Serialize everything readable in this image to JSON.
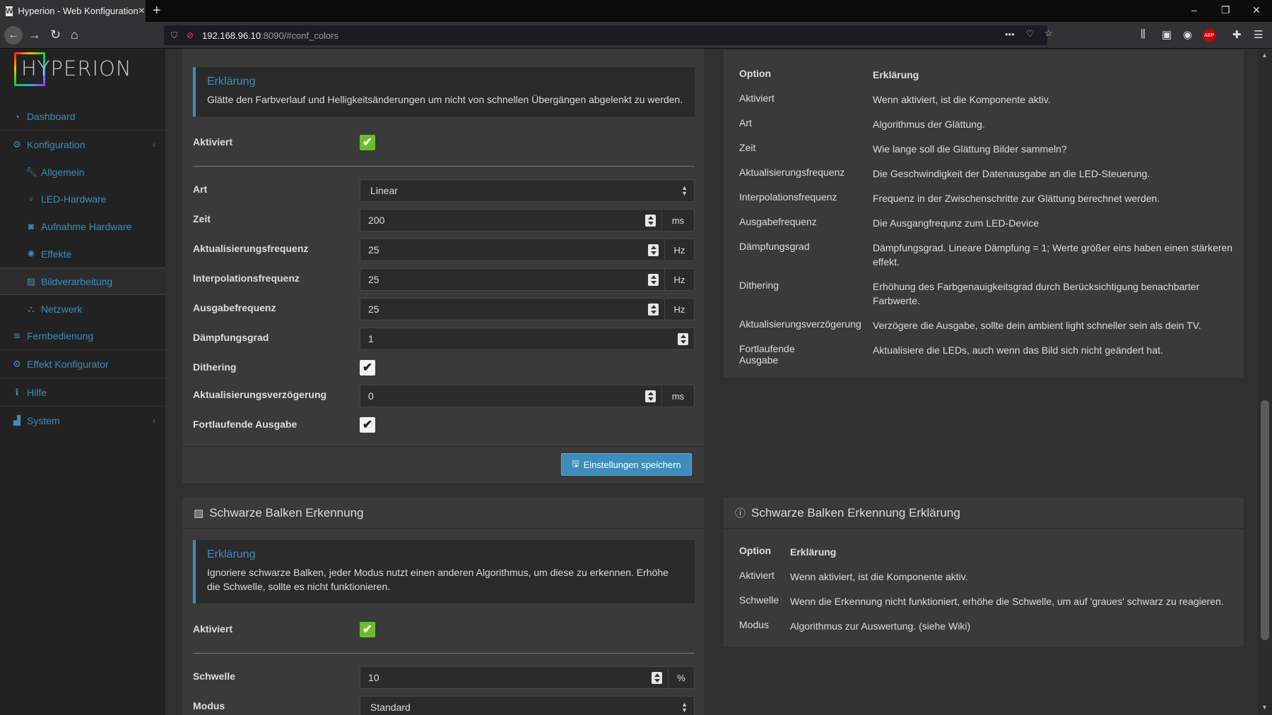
{
  "browser": {
    "tab_title": "Hyperion - Web Konfiguration",
    "favicon": "W",
    "url_host": "192.168.96.10",
    "url_rest": ":8090/#conf_colors"
  },
  "sidebar": {
    "logo_text": "HYPERION",
    "items": [
      {
        "label": "Dashboard",
        "icon": "dashboard-icon"
      },
      {
        "label": "Konfiguration",
        "icon": "gear-icon"
      },
      {
        "label": "Allgemein",
        "icon": "wrench-icon"
      },
      {
        "label": "LED-Hardware",
        "icon": "lightbulb-icon"
      },
      {
        "label": "Aufnahme Hardware",
        "icon": "camera-icon"
      },
      {
        "label": "Effekte",
        "icon": "spinner-icon"
      },
      {
        "label": "Bildverarbeitung",
        "icon": "picture-icon"
      },
      {
        "label": "Netzwerk",
        "icon": "network-icon"
      },
      {
        "label": "Fernbedienung",
        "icon": "wifi-icon"
      },
      {
        "label": "Effekt Konfigurator",
        "icon": "cogs-icon"
      },
      {
        "label": "Hilfe",
        "icon": "info-icon"
      },
      {
        "label": "System",
        "icon": "chart-icon"
      }
    ]
  },
  "smoothing": {
    "callout_title": "Erklärung",
    "callout_text": "Glätte den Farbverlauf und Helligkeitsänderungen um nicht von schnellen Übergängen abgelenkt zu werden.",
    "enabled_label": "Aktiviert",
    "art_label": "Art",
    "art_value": "Linear",
    "zeit_label": "Zeit",
    "zeit_value": "200",
    "zeit_unit": "ms",
    "update_freq_label": "Aktualisierungsfrequenz",
    "update_freq_value": "25",
    "update_freq_unit": "Hz",
    "interp_label": "Interpolationsfrequenz",
    "interp_value": "25",
    "interp_unit": "Hz",
    "output_label": "Ausgabefrequenz",
    "output_value": "25",
    "output_unit": "Hz",
    "damping_label": "Dämpfungsgrad",
    "damping_value": "1",
    "dithering_label": "Dithering",
    "delay_label": "Aktualisierungsverzögerung",
    "delay_value": "0",
    "delay_unit": "ms",
    "continuous_label": "Fortlaufende Ausgabe",
    "save_label": "Einstellungen speichern"
  },
  "smoothing_help": {
    "head_option": "Option",
    "head_explain": "Erklärung",
    "rows": [
      {
        "option": "Aktiviert",
        "text": "Wenn aktiviert, ist die Komponente aktiv."
      },
      {
        "option": "Art",
        "text": "Algorithmus der Glättung."
      },
      {
        "option": "Zeit",
        "text": "Wie lange soll die Glättung Bilder sammeln?"
      },
      {
        "option": "Aktualisierungsfrequenz",
        "text": "Die Geschwindigkeit der Datenausgabe an die LED-Steuerung."
      },
      {
        "option": "Interpolationsfrequenz",
        "text": "Frequenz in der Zwischenschritte zur Glättung berechnet werden."
      },
      {
        "option": "Ausgabefrequenz",
        "text": "Die Ausgangfrequnz zum LED-Device"
      },
      {
        "option": "Dämpfungsgrad",
        "text": "Dämpfungsgrad. Lineare Dämpfung = 1; Werte größer eins haben einen stärkeren effekt."
      },
      {
        "option": "Dithering",
        "text": "Erhöhung des Farbgenauigkeitsgrad durch Berücksichtigung benachbarter Farbwerte."
      },
      {
        "option": "Aktualisierungsverzögerung",
        "text": "Verzögere die Ausgabe, sollte dein ambient light schneller sein als dein TV."
      },
      {
        "option": "Fortlaufende Ausgabe",
        "text": "Aktualisiere die LEDs, auch wenn das Bild sich nicht geändert hat."
      }
    ]
  },
  "blackbar": {
    "title": "Schwarze Balken Erkennung",
    "callout_title": "Erklärung",
    "callout_text": "Ignoriere schwarze Balken, jeder Modus nutzt einen anderen Algorithmus, um diese zu erkennen. Erhöhe die Schwelle, sollte es nicht funktionieren.",
    "enabled_label": "Aktiviert",
    "threshold_label": "Schwelle",
    "threshold_value": "10",
    "threshold_unit": "%",
    "mode_label": "Modus",
    "mode_value": "Standard"
  },
  "blackbar_help": {
    "title": "Schwarze Balken Erkennung Erklärung",
    "head_option": "Option",
    "head_explain": "Erklärung",
    "rows": [
      {
        "option": "Aktiviert",
        "text": "Wenn aktiviert, ist die Komponente aktiv."
      },
      {
        "option": "Schwelle",
        "text": "Wenn die Erkennung nicht funktioniert, erhöhe die Schwelle, um auf 'graues' schwarz zu reagieren."
      },
      {
        "option": "Modus",
        "text": "Algorithmus zur Auswertung. (siehe Wiki)"
      }
    ]
  },
  "colors": {
    "accent": "#3c8dbc",
    "checkbox_green": "#6abe2a"
  }
}
